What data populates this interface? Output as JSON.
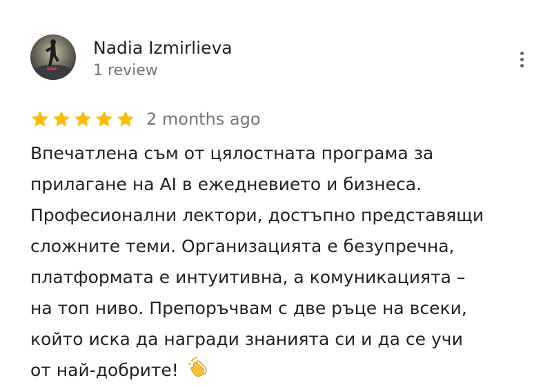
{
  "reviewer": {
    "name": "Nadia Izmirlieva",
    "review_count": "1 review",
    "avatar": "reviewer-avatar-photo"
  },
  "menu": {
    "icon": "more-vert-icon"
  },
  "rating": {
    "stars": 5,
    "max": 5,
    "star_color": "#fbbc04",
    "date": "2 months ago"
  },
  "review": {
    "lines": [
      "Впечатлена съм от цялостната програма за",
      "прилагане на AI в ежедневието и бизнеса.",
      "Професионални лектори, достъпно представящи",
      "сложните теми. Организацията е безупречна,",
      "платформата е интуитивна, а комуникацията –",
      "на топ ниво. Препоръчвам с две ръце на всеки,",
      "който иска да награди знанията си и да се учи",
      "от най-добрите!"
    ],
    "emoji": "clapping-hands-icon"
  }
}
